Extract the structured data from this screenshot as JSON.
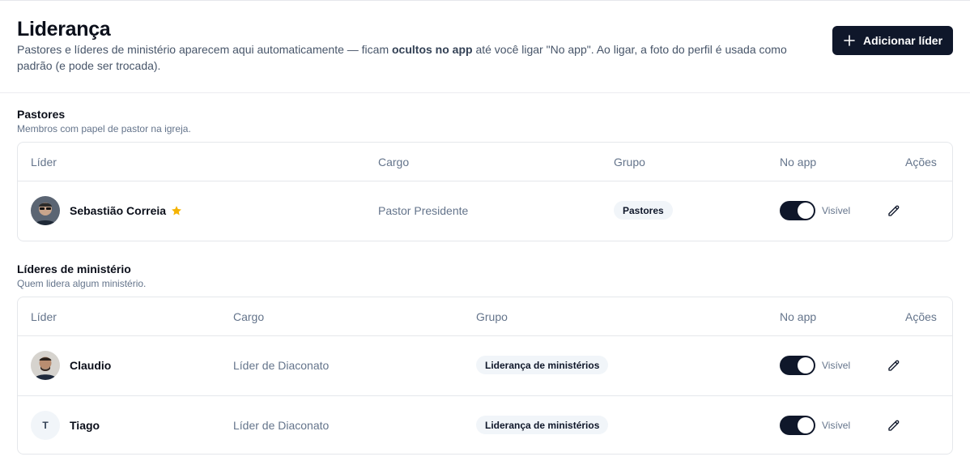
{
  "header": {
    "title": "Liderança",
    "desc_before": "Pastores e líderes de ministério aparecem aqui automaticamente — ficam ",
    "desc_bold": "ocultos no app",
    "desc_after": " até você ligar \"No app\". Ao ligar, a foto do perfil é usada como padrão (e pode ser trocada).",
    "add_button": "Adicionar líder"
  },
  "sections": [
    {
      "title": "Pastores",
      "subtitle": "Membros com papel de pastor na igreja.",
      "columns": [
        "Líder",
        "Cargo",
        "Grupo",
        "No app",
        "Ações"
      ],
      "rows": [
        {
          "name": "Sebastião Correia",
          "cargo": "Pastor Presidente",
          "grupo": "Pastores",
          "toggle_on": true,
          "visibility": "Visível",
          "starred": true
        }
      ]
    },
    {
      "title": "Líderes de ministério",
      "subtitle": "Quem lidera algum ministério.",
      "columns": [
        "Líder",
        "Cargo",
        "Grupo",
        "No app",
        "Ações"
      ],
      "rows": [
        {
          "name": "Claudio",
          "cargo": "Líder de Diaconato",
          "grupo": "Liderança de ministérios",
          "toggle_on": true,
          "visibility": "Visível"
        },
        {
          "name": "Tiago",
          "initial": "T",
          "cargo": "Líder de Diaconato",
          "grupo": "Liderança de ministérios",
          "toggle_on": true,
          "visibility": "Visível"
        }
      ]
    }
  ],
  "colors": {
    "primary": "#0f172a",
    "muted": "#64748b",
    "badge_bg": "#f1f5f9",
    "star": "#f5b301",
    "border": "#e5e7eb"
  },
  "icons": {
    "add": "plus-icon",
    "edit": "pencil-icon",
    "star": "star-icon"
  }
}
